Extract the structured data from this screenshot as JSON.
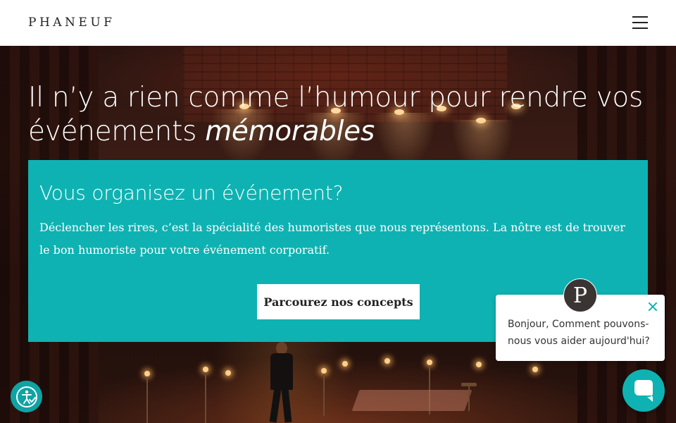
{
  "header": {
    "logo": "PHANEUF",
    "menu_icon": "hamburger-menu-icon"
  },
  "hero": {
    "headline_main": "Il n’y a rien comme l’humour pour rendre vos événements",
    "headline_emphasis": "mémorables"
  },
  "card": {
    "title": "Vous organisez un événement?",
    "text": "Déclencher les rires, c’est la spécialité des humoristes que nous représentons. La nôtre est de trouver le bon humoriste pour votre événement corporatif.",
    "cta_label": "Parcourez nos concepts",
    "background": "#0fb2b2"
  },
  "chat": {
    "avatar_letter": "P",
    "message": "Bonjour, Comment pouvons-nous vous aider aujourd'hui?",
    "close_icon": "close-icon",
    "launcher_icon": "chat-icon",
    "accent": "#0fb2b2"
  },
  "accessibility": {
    "icon": "accessibility-icon"
  }
}
